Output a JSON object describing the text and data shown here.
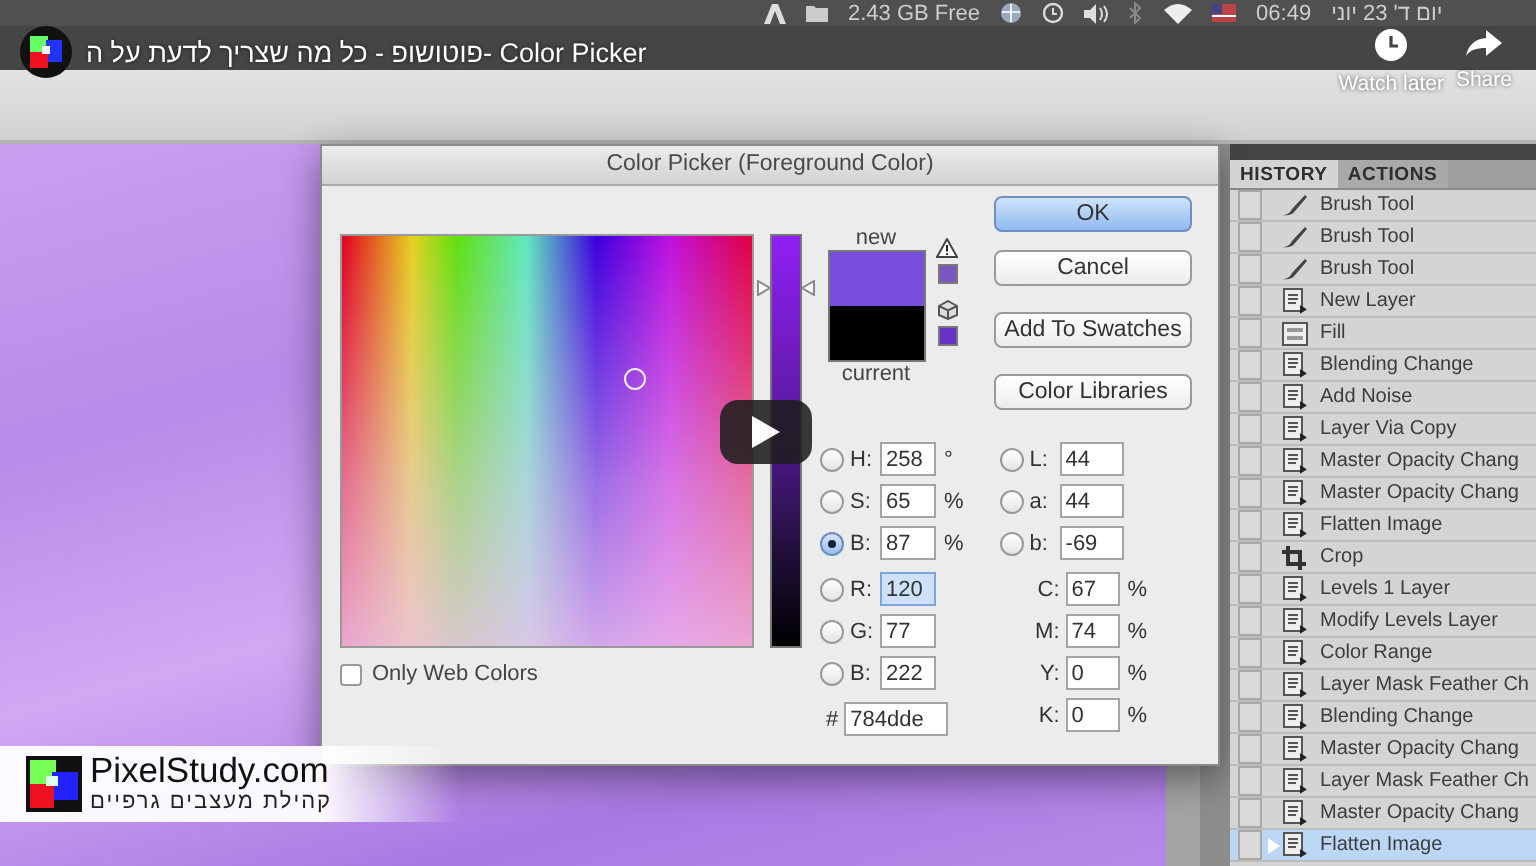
{
  "menu_bar": {
    "disk_free": "2.43 GB Free",
    "time": "06:49",
    "date": "יום ד' 23 יוני"
  },
  "video": {
    "title": "פוטושופ - כל מה שצריך לדעת על ה- Color Picker",
    "actions": [
      {
        "kind": "watch_later",
        "label": "Watch later"
      },
      {
        "kind": "share",
        "label": "Share"
      }
    ]
  },
  "dialog": {
    "title": "Color Picker (Foreground Color)",
    "new_label": "new",
    "current_label": "current",
    "buttons": [
      {
        "label": "OK",
        "default": true
      },
      {
        "label": "Cancel",
        "default": false
      },
      {
        "label": "Add To Swatches",
        "default": false
      },
      {
        "label": "Color Libraries",
        "default": false
      }
    ],
    "slider": {
      "level": 0.87
    },
    "only_web_colors": {
      "label": "Only Web Colors",
      "checked": false
    },
    "hsb": [
      {
        "label": "H:",
        "value": "258",
        "unit": "°",
        "selected": false
      },
      {
        "label": "S:",
        "value": "65",
        "unit": "%",
        "selected": false
      },
      {
        "label": "B:",
        "value": "87",
        "unit": "%",
        "selected": true
      }
    ],
    "rgb": [
      {
        "label": "R:",
        "value": "120",
        "selected": false,
        "focused": true
      },
      {
        "label": "G:",
        "value": "77",
        "selected": false,
        "focused": false
      },
      {
        "label": "B:",
        "value": "222",
        "selected": false,
        "focused": false
      }
    ],
    "hex": {
      "label": "#",
      "value": "784dde"
    },
    "lab": [
      {
        "label": "L:",
        "value": "44",
        "selected": false
      },
      {
        "label": "a:",
        "value": "44",
        "selected": false
      },
      {
        "label": "b:",
        "value": "-69",
        "selected": false
      }
    ],
    "cmyk": [
      {
        "label": "C:",
        "value": "67",
        "unit": "%"
      },
      {
        "label": "M:",
        "value": "74",
        "unit": "%"
      },
      {
        "label": "Y:",
        "value": "0",
        "unit": "%"
      },
      {
        "label": "K:",
        "value": "0",
        "unit": "%"
      }
    ]
  },
  "history": {
    "tabs": [
      {
        "label": "HISTORY",
        "selected": true
      },
      {
        "label": "ACTIONS",
        "selected": false
      }
    ],
    "items": [
      {
        "kind": "brush",
        "label": "Brush Tool",
        "selected": false
      },
      {
        "kind": "brush",
        "label": "Brush Tool",
        "selected": false
      },
      {
        "kind": "brush",
        "label": "Brush Tool",
        "selected": false
      },
      {
        "kind": "step",
        "label": "New Layer",
        "selected": false
      },
      {
        "kind": "fill",
        "label": "Fill",
        "selected": false
      },
      {
        "kind": "step",
        "label": "Blending Change",
        "selected": false
      },
      {
        "kind": "step",
        "label": "Add Noise",
        "selected": false
      },
      {
        "kind": "step",
        "label": "Layer Via Copy",
        "selected": false
      },
      {
        "kind": "step",
        "label": "Master Opacity Chang",
        "selected": false
      },
      {
        "kind": "step",
        "label": "Master Opacity Chang",
        "selected": false
      },
      {
        "kind": "step",
        "label": "Flatten Image",
        "selected": false
      },
      {
        "kind": "crop",
        "label": "Crop",
        "selected": false
      },
      {
        "kind": "step",
        "label": "Levels 1 Layer",
        "selected": false
      },
      {
        "kind": "step",
        "label": "Modify Levels Layer",
        "selected": false
      },
      {
        "kind": "step",
        "label": "Color Range",
        "selected": false
      },
      {
        "kind": "step",
        "label": "Layer Mask Feather Ch",
        "selected": false
      },
      {
        "kind": "step",
        "label": "Blending Change",
        "selected": false
      },
      {
        "kind": "step",
        "label": "Master Opacity Chang",
        "selected": false
      },
      {
        "kind": "step",
        "label": "Layer Mask Feather Ch",
        "selected": false
      },
      {
        "kind": "step",
        "label": "Master Opacity Chang",
        "selected": false
      },
      {
        "kind": "step",
        "label": "Flatten Image",
        "selected": true
      }
    ]
  },
  "logo": {
    "name": "PixelStudy.com",
    "tagline": "קהילת מעצבים גרפיים"
  }
}
